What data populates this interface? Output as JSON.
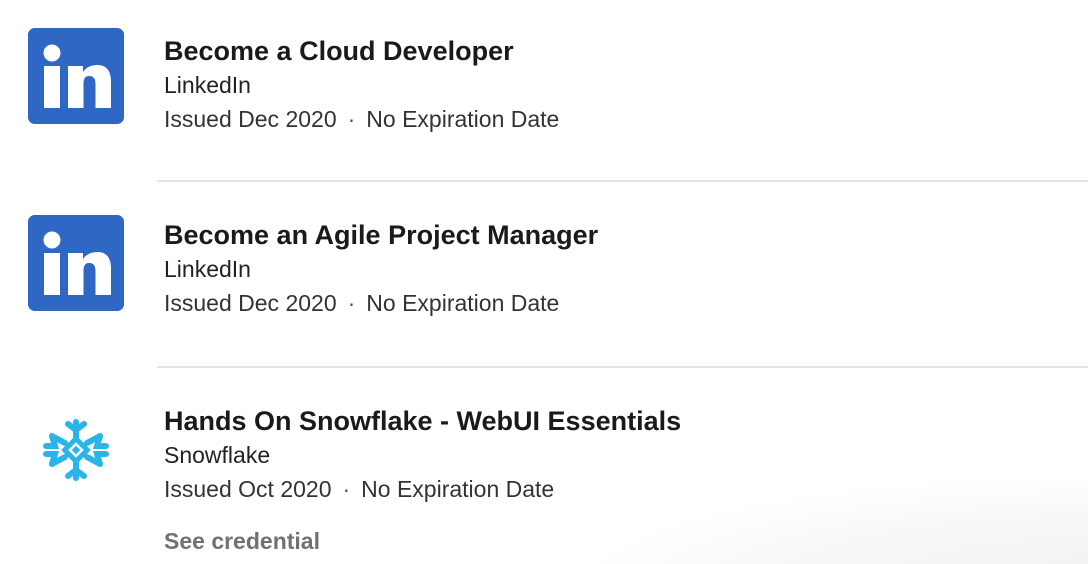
{
  "certifications": [
    {
      "title": "Become a Cloud Developer",
      "issuer": "LinkedIn",
      "issued": "Issued Dec 2020",
      "separator": "·",
      "expiration": "No Expiration Date",
      "logo_icon": "linkedin-logo-icon"
    },
    {
      "title": "Become an Agile Project Manager",
      "issuer": "LinkedIn",
      "issued": "Issued Dec 2020",
      "separator": "·",
      "expiration": "No Expiration Date",
      "logo_icon": "linkedin-logo-icon"
    },
    {
      "title": "Hands On Snowflake - WebUI Essentials",
      "issuer": "Snowflake",
      "issued": "Issued Oct 2020",
      "separator": "·",
      "expiration": "No Expiration Date",
      "logo_icon": "snowflake-logo-icon",
      "action_label": "See credential"
    }
  ],
  "colors": {
    "linkedin_blue": "#2f67c4",
    "snowflake_blue": "#29b5e8",
    "divider": "#e3e3e3",
    "muted_action": "#717171"
  }
}
